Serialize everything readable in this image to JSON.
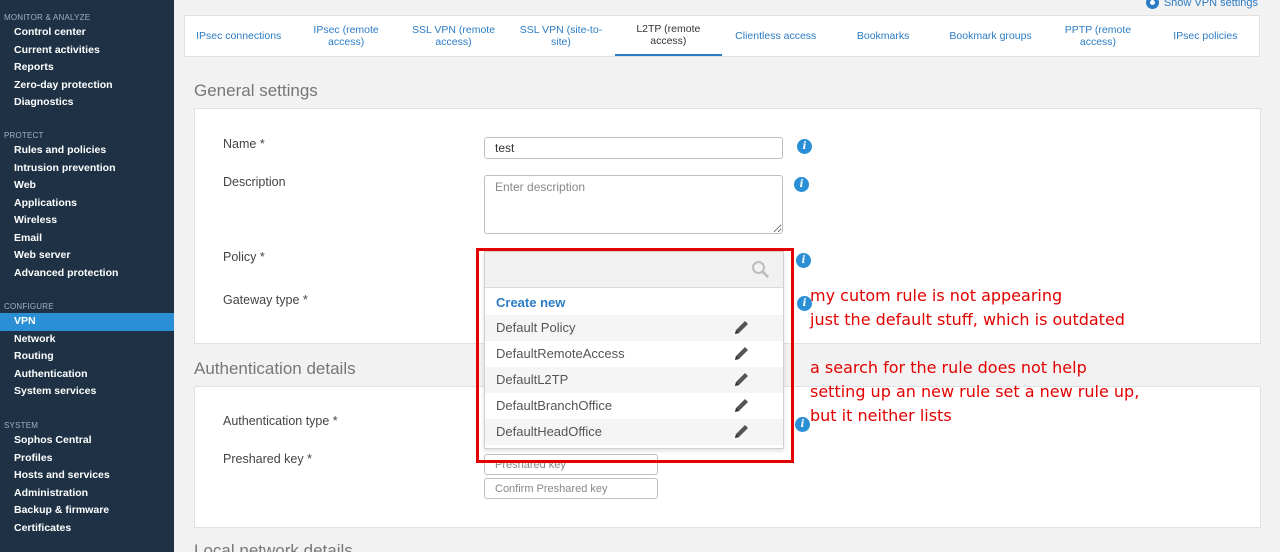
{
  "sidebar": {
    "sections": [
      {
        "header": "MONITOR & ANALYZE",
        "items": [
          "Control center",
          "Current activities",
          "Reports",
          "Zero-day protection",
          "Diagnostics"
        ]
      },
      {
        "header": "PROTECT",
        "items": [
          "Rules and policies",
          "Intrusion prevention",
          "Web",
          "Applications",
          "Wireless",
          "Email",
          "Web server",
          "Advanced protection"
        ]
      },
      {
        "header": "CONFIGURE",
        "items": [
          "VPN",
          "Network",
          "Routing",
          "Authentication",
          "System services"
        ]
      },
      {
        "header": "SYSTEM",
        "items": [
          "Sophos Central",
          "Profiles",
          "Hosts and services",
          "Administration",
          "Backup & firmware",
          "Certificates"
        ]
      }
    ],
    "active_item": "VPN"
  },
  "header": {
    "show_vpn_settings": "Show VPN settings"
  },
  "tabs": [
    {
      "label": "IPsec connections"
    },
    {
      "label": "IPsec (remote access)"
    },
    {
      "label": "SSL VPN (remote access)"
    },
    {
      "label": "SSL VPN (site-to-site)"
    },
    {
      "label": "L2TP (remote access)"
    },
    {
      "label": "Clientless access"
    },
    {
      "label": "Bookmarks"
    },
    {
      "label": "Bookmark groups"
    },
    {
      "label": "PPTP (remote access)"
    },
    {
      "label": "IPsec policies"
    }
  ],
  "active_tab": "L2TP (remote access)",
  "general": {
    "title": "General settings",
    "name_label": "Name *",
    "name_value": "test",
    "description_label": "Description",
    "description_placeholder": "Enter description",
    "policy_label": "Policy *",
    "gateway_label": "Gateway type *"
  },
  "auth": {
    "title": "Authentication details",
    "type_label": "Authentication type *",
    "psk_label": "Preshared key *",
    "psk_placeholder": "Preshared key",
    "confirm_placeholder": "Confirm Preshared key"
  },
  "local_network": {
    "title": "Local network details"
  },
  "dropdown": {
    "search_value": "",
    "create_new": "Create new",
    "options": [
      "Default Policy",
      "DefaultRemoteAccess",
      "DefaultL2TP",
      "DefaultBranchOffice",
      "DefaultHeadOffice"
    ]
  },
  "annotations": [
    "my cutom rule is not appearing",
    "just the default stuff, which is outdated",
    "a search for the rule does not help",
    "setting up an new rule set a new rule up,",
    "but it neither lists"
  ],
  "colors": {
    "sidebar_bg": "#1f3245",
    "active_blue": "#2b8fd6",
    "link_blue": "#2b7cc4",
    "annotation_red": "#e30000"
  }
}
